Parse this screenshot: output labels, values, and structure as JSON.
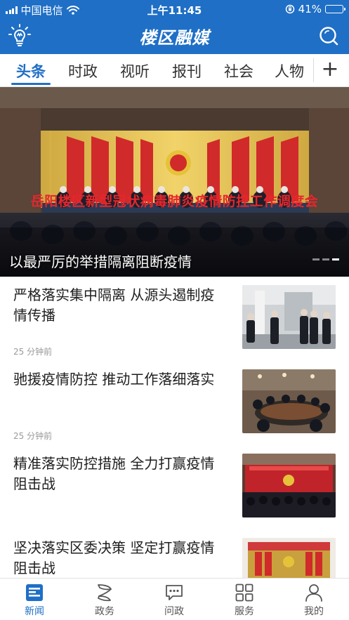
{
  "status_bar": {
    "carrier": "中国电信",
    "time": "上午11:45",
    "battery_text": "41%",
    "battery_level": 0.41
  },
  "app_bar": {
    "brand": "楼区融媒",
    "left_icon": "lightbulb-icon",
    "right_icon": "search-icon"
  },
  "tabs": {
    "items": [
      "头条",
      "时政",
      "视听",
      "报刊",
      "社会",
      "人物"
    ],
    "active": "头条",
    "add_label": "+"
  },
  "hero": {
    "banner": "岳阳楼区新型冠状病毒肺炎疫情防控工作调度会",
    "caption": "以最严厉的举措隔离阻断疫情"
  },
  "news": [
    {
      "title": "严格落实集中隔离 从源头遏制疫情传播",
      "time": "25 分钟前"
    },
    {
      "title": "驰援疫情防控 推动工作落细落实",
      "time": "25 分钟前"
    },
    {
      "title": "精准落实防控措施 全力打赢疫情阻击战",
      "time": ""
    },
    {
      "title": "坚决落实区委决策 坚定打赢疫情阻击战",
      "time": ""
    }
  ],
  "bottom_nav": {
    "items": [
      {
        "label": "新闻",
        "icon": "news-icon"
      },
      {
        "label": "政务",
        "icon": "government-icon"
      },
      {
        "label": "问政",
        "icon": "chat-icon"
      },
      {
        "label": "服务",
        "icon": "grid-icon"
      },
      {
        "label": "我的",
        "icon": "user-icon"
      }
    ],
    "active": "新闻"
  },
  "colors": {
    "brand_blue": "#1f6fc6",
    "banner_red": "#e6262c"
  }
}
